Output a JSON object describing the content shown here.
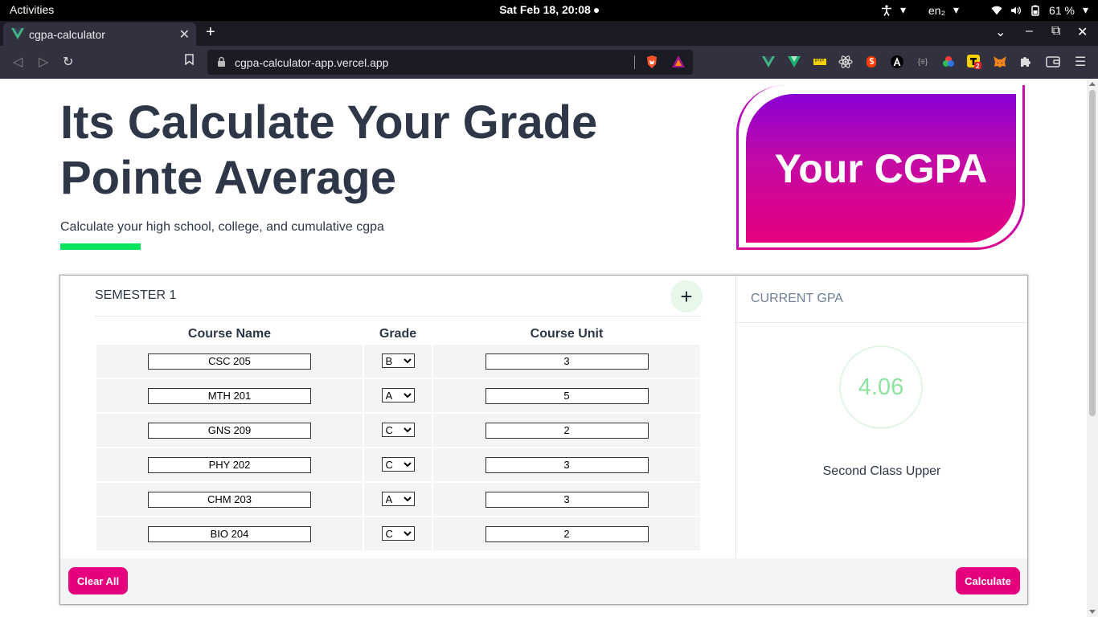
{
  "os": {
    "activities": "Activities",
    "clock": "Sat Feb 18, 20:08",
    "keyboard_layout": "en₂",
    "battery": "61 %"
  },
  "browser": {
    "tab_title": "cgpa-calculator",
    "url": "cgpa-calculator-app.vercel.app",
    "extensions": [
      "vue-devtools-icon",
      "vuetify-icon",
      "ruler-icon",
      "react-devtools-icon",
      "svelte-devtools-icon",
      "angular-devtools-icon",
      "json-icon",
      "color-picker-icon",
      "todo-icon",
      "metamask-icon",
      "puzzle-icon"
    ],
    "todo_badge": "2"
  },
  "hero": {
    "title": "Its Calculate Your Grade Pointe Average",
    "subtitle": "Calculate your high school, college, and cumulative cgpa",
    "card_text": "Your CGPA"
  },
  "calculator": {
    "semester_title": "SEMESTER 1",
    "add_label": "+",
    "columns": [
      "Course Name",
      "Grade",
      "Course Unit"
    ],
    "courses": [
      {
        "name": "CSC 205",
        "grade": "B",
        "unit": "3"
      },
      {
        "name": "MTH 201",
        "grade": "A",
        "unit": "5"
      },
      {
        "name": "GNS 209",
        "grade": "C",
        "unit": "2"
      },
      {
        "name": "PHY 202",
        "grade": "C",
        "unit": "3"
      },
      {
        "name": "CHM 203",
        "grade": "A",
        "unit": "3"
      },
      {
        "name": "BIO 204",
        "grade": "C",
        "unit": "2"
      }
    ],
    "clear_label": "Clear All",
    "calculate_label": "Calculate"
  },
  "result": {
    "title": "CURRENT GPA",
    "gpa": "4.06",
    "class": "Second Class Upper"
  },
  "colors": {
    "accent_pink": "#e6007e",
    "accent_green": "#00e35a",
    "gpa_green": "#8ce39d",
    "heading": "#2d3748"
  }
}
